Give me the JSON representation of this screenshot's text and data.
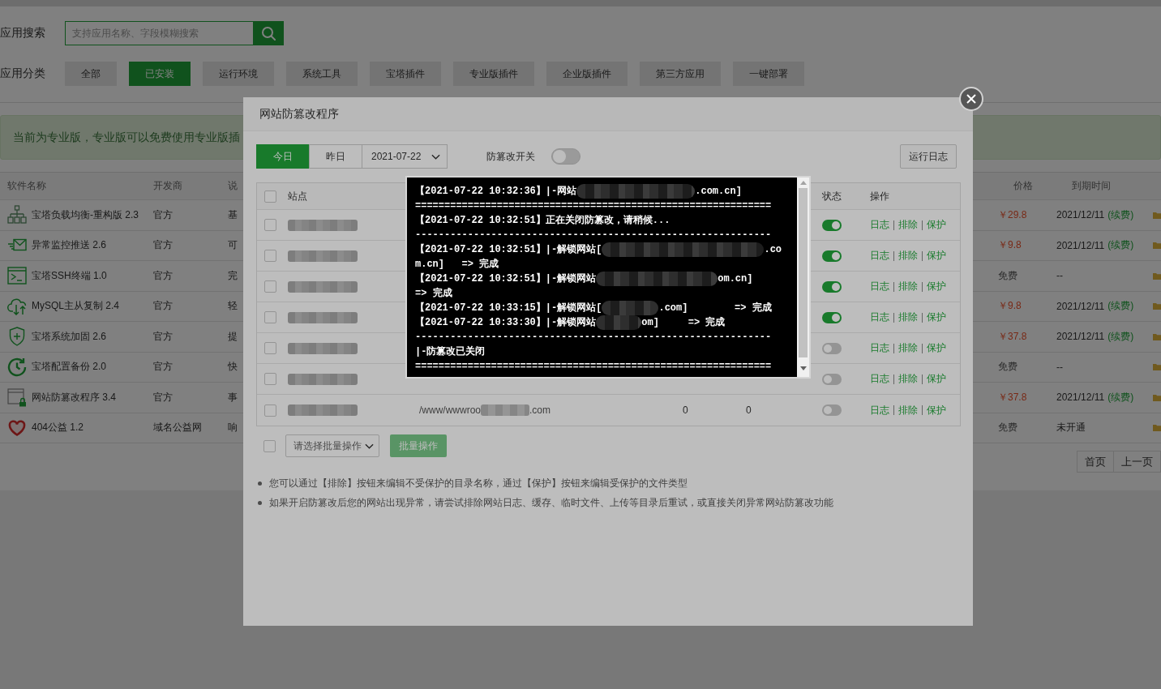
{
  "page": {
    "search": {
      "label": "应用搜索",
      "placeholder": "支持应用名称、字段模糊搜索"
    },
    "categories": {
      "label": "应用分类",
      "items": [
        {
          "label": "全部",
          "selected": false
        },
        {
          "label": "已安装",
          "selected": true
        },
        {
          "label": "运行环境",
          "selected": false
        },
        {
          "label": "系统工具",
          "selected": false
        },
        {
          "label": "宝塔插件",
          "selected": false
        },
        {
          "label": "专业版插件",
          "selected": false
        },
        {
          "label": "企业版插件",
          "selected": false
        },
        {
          "label": "第三方应用",
          "selected": false
        },
        {
          "label": "一键部署",
          "selected": false
        }
      ]
    },
    "notice": "当前为专业版，专业版可以免费使用专业版插",
    "table": {
      "columns": [
        "软件名称",
        "开发商",
        "说",
        "价格",
        "到期时间"
      ],
      "rows": [
        {
          "name": "宝塔负载均衡-重构版 2.3",
          "developer": "官方",
          "description": "基",
          "price": "￥29.8",
          "paid": true,
          "expires": "2021/12/11",
          "renew": "(续费)"
        },
        {
          "name": "异常监控推送 2.6",
          "developer": "官方",
          "description": "可",
          "price": "￥9.8",
          "paid": true,
          "expires": "2021/12/11",
          "renew": "(续费)"
        },
        {
          "name": "宝塔SSH终端 1.0",
          "developer": "官方",
          "description": "完",
          "price": "免费",
          "paid": false,
          "expires": "--"
        },
        {
          "name": "MySQL主从复制 2.4",
          "developer": "官方",
          "description": "轻",
          "price": "￥9.8",
          "paid": true,
          "expires": "2021/12/11",
          "renew": "(续费)"
        },
        {
          "name": "宝塔系统加固 2.6",
          "developer": "官方",
          "description": "提",
          "price": "￥37.8",
          "paid": true,
          "expires": "2021/12/11",
          "renew": "(续费)"
        },
        {
          "name": "宝塔配置备份 2.0",
          "developer": "官方",
          "description": "快",
          "price": "免费",
          "paid": false,
          "expires": "--"
        },
        {
          "name": "网站防篡改程序 3.4",
          "developer": "官方",
          "description": "事",
          "price": "￥37.8",
          "paid": true,
          "expires": "2021/12/11",
          "renew": "(续费)"
        },
        {
          "name": "404公益 1.2",
          "developer": "域名公益网",
          "description": "响",
          "price": "免费",
          "paid": false,
          "expires": "未开通"
        }
      ]
    },
    "pagination": [
      "首页",
      "上一页"
    ]
  },
  "dialog": {
    "title": "网站防篡改程序",
    "day_tabs": [
      {
        "label": "今日",
        "selected": true
      },
      {
        "label": "昨日",
        "selected": false
      }
    ],
    "date": "2021-07-22",
    "switch": {
      "label": "防篡改开关",
      "on": false
    },
    "log_button": "运行日志",
    "table": {
      "select_all": {
        "checked": false
      },
      "columns": [
        "站点",
        "状态",
        "操作"
      ],
      "rows": [
        {
          "checked": false,
          "on": true,
          "actions": [
            "日志",
            "排除",
            "保护"
          ]
        },
        {
          "checked": false,
          "on": true,
          "actions": [
            "日志",
            "排除",
            "保护"
          ]
        },
        {
          "checked": false,
          "on": true,
          "actions": [
            "日志",
            "排除",
            "保护"
          ]
        },
        {
          "checked": false,
          "on": true,
          "actions": [
            "日志",
            "排除",
            "保护"
          ]
        },
        {
          "checked": false,
          "on": false,
          "actions": [
            "日志",
            "排除",
            "保护"
          ]
        },
        {
          "checked": false,
          "on": false,
          "actions": [
            "日志",
            "排除",
            "保护"
          ]
        },
        {
          "checked": false,
          "on": false,
          "path_start": "/www/wwwroo",
          "path_end": ".com",
          "count_1": "0",
          "count_2": "0",
          "actions": [
            "日志",
            "排除",
            "保护"
          ]
        }
      ]
    },
    "batch": {
      "select_all": {
        "checked": false
      },
      "select": "请选择批量操作",
      "button": {
        "label": "批量操作",
        "disabled": true
      }
    },
    "tips": [
      "您可以通过【排除】按钮来编辑不受保护的目录名称，通过【保护】按钮来编辑受保护的文件类型",
      "如果开启防篡改后您的网站出现异常，请尝试排除网站日志、缓存、临时文件、上传等目录后重试，或直接关闭异常网站防篡改功能"
    ]
  },
  "log_popup": {
    "lines": [
      [
        {
          "kind": "text",
          "text": "【2021-07-22 10:32:36】|-网站"
        },
        {
          "kind": "redacted"
        },
        {
          "kind": "text",
          "text": ".com.cn]"
        }
      ],
      [
        {
          "kind": "text",
          "text": "============================================================="
        }
      ],
      [
        {
          "kind": "text",
          "text": "【2021-07-22 10:32:51】正在关闭防篡改，请稍候..."
        }
      ],
      [
        {
          "kind": "text",
          "text": "-------------------------------------------------------------"
        }
      ],
      [
        {
          "kind": "text",
          "text": "【2021-07-22 10:32:51】|-解锁网站["
        },
        {
          "kind": "redacted"
        },
        {
          "kind": "text",
          "text": ".co"
        }
      ],
      [
        {
          "kind": "text",
          "text": "m.cn]   => 完成"
        }
      ],
      [
        {
          "kind": "text",
          "text": "【2021-07-22 10:32:51】|-解锁网站"
        },
        {
          "kind": "redacted"
        },
        {
          "kind": "text",
          "text": "om.cn]"
        }
      ],
      [
        {
          "kind": "text",
          "text": "=> 完成"
        }
      ],
      [
        {
          "kind": "text",
          "text": "【2021-07-22 10:33:15】|-解锁网站["
        },
        {
          "kind": "redacted"
        },
        {
          "kind": "text",
          "text": ".com]        => 完成"
        }
      ],
      [
        {
          "kind": "text",
          "text": "【2021-07-22 10:33:30】|-解锁网站"
        },
        {
          "kind": "redacted"
        },
        {
          "kind": "text",
          "text": "om]     => 完成"
        }
      ],
      [
        {
          "kind": "text",
          "text": "-------------------------------------------------------------"
        }
      ],
      [
        {
          "kind": "text",
          "text": "|-防篡改已关闭"
        }
      ],
      [
        {
          "kind": "text",
          "text": "============================================================="
        }
      ]
    ]
  }
}
